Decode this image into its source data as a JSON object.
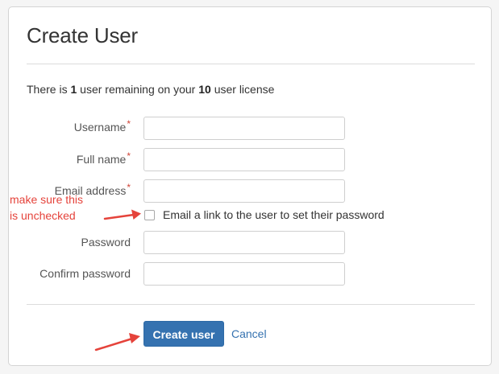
{
  "dialog": {
    "title": "Create User",
    "license": {
      "prefix": "There is ",
      "remaining": "1",
      "middle": " user remaining on your ",
      "total": "10",
      "suffix": " user license"
    },
    "fields": [
      {
        "label": "Username",
        "required_mark": "*",
        "value": ""
      },
      {
        "label": "Full name",
        "required_mark": "*",
        "value": ""
      },
      {
        "label": "Email address",
        "required_mark": "*",
        "value": ""
      },
      {
        "label": "Password",
        "required_mark": "",
        "value": ""
      },
      {
        "label": "Confirm password",
        "required_mark": "",
        "value": ""
      }
    ],
    "email_link_checkbox": {
      "label": "Email a link to the user to set their password",
      "checked": false
    },
    "actions": {
      "submit_label": "Create user",
      "cancel_label": "Cancel"
    }
  },
  "annotations": {
    "note_line1": "make sure this",
    "note_line2": "is unchecked",
    "color": "#e5433b"
  },
  "colors": {
    "primary": "#3572b0",
    "required": "#d04437"
  }
}
